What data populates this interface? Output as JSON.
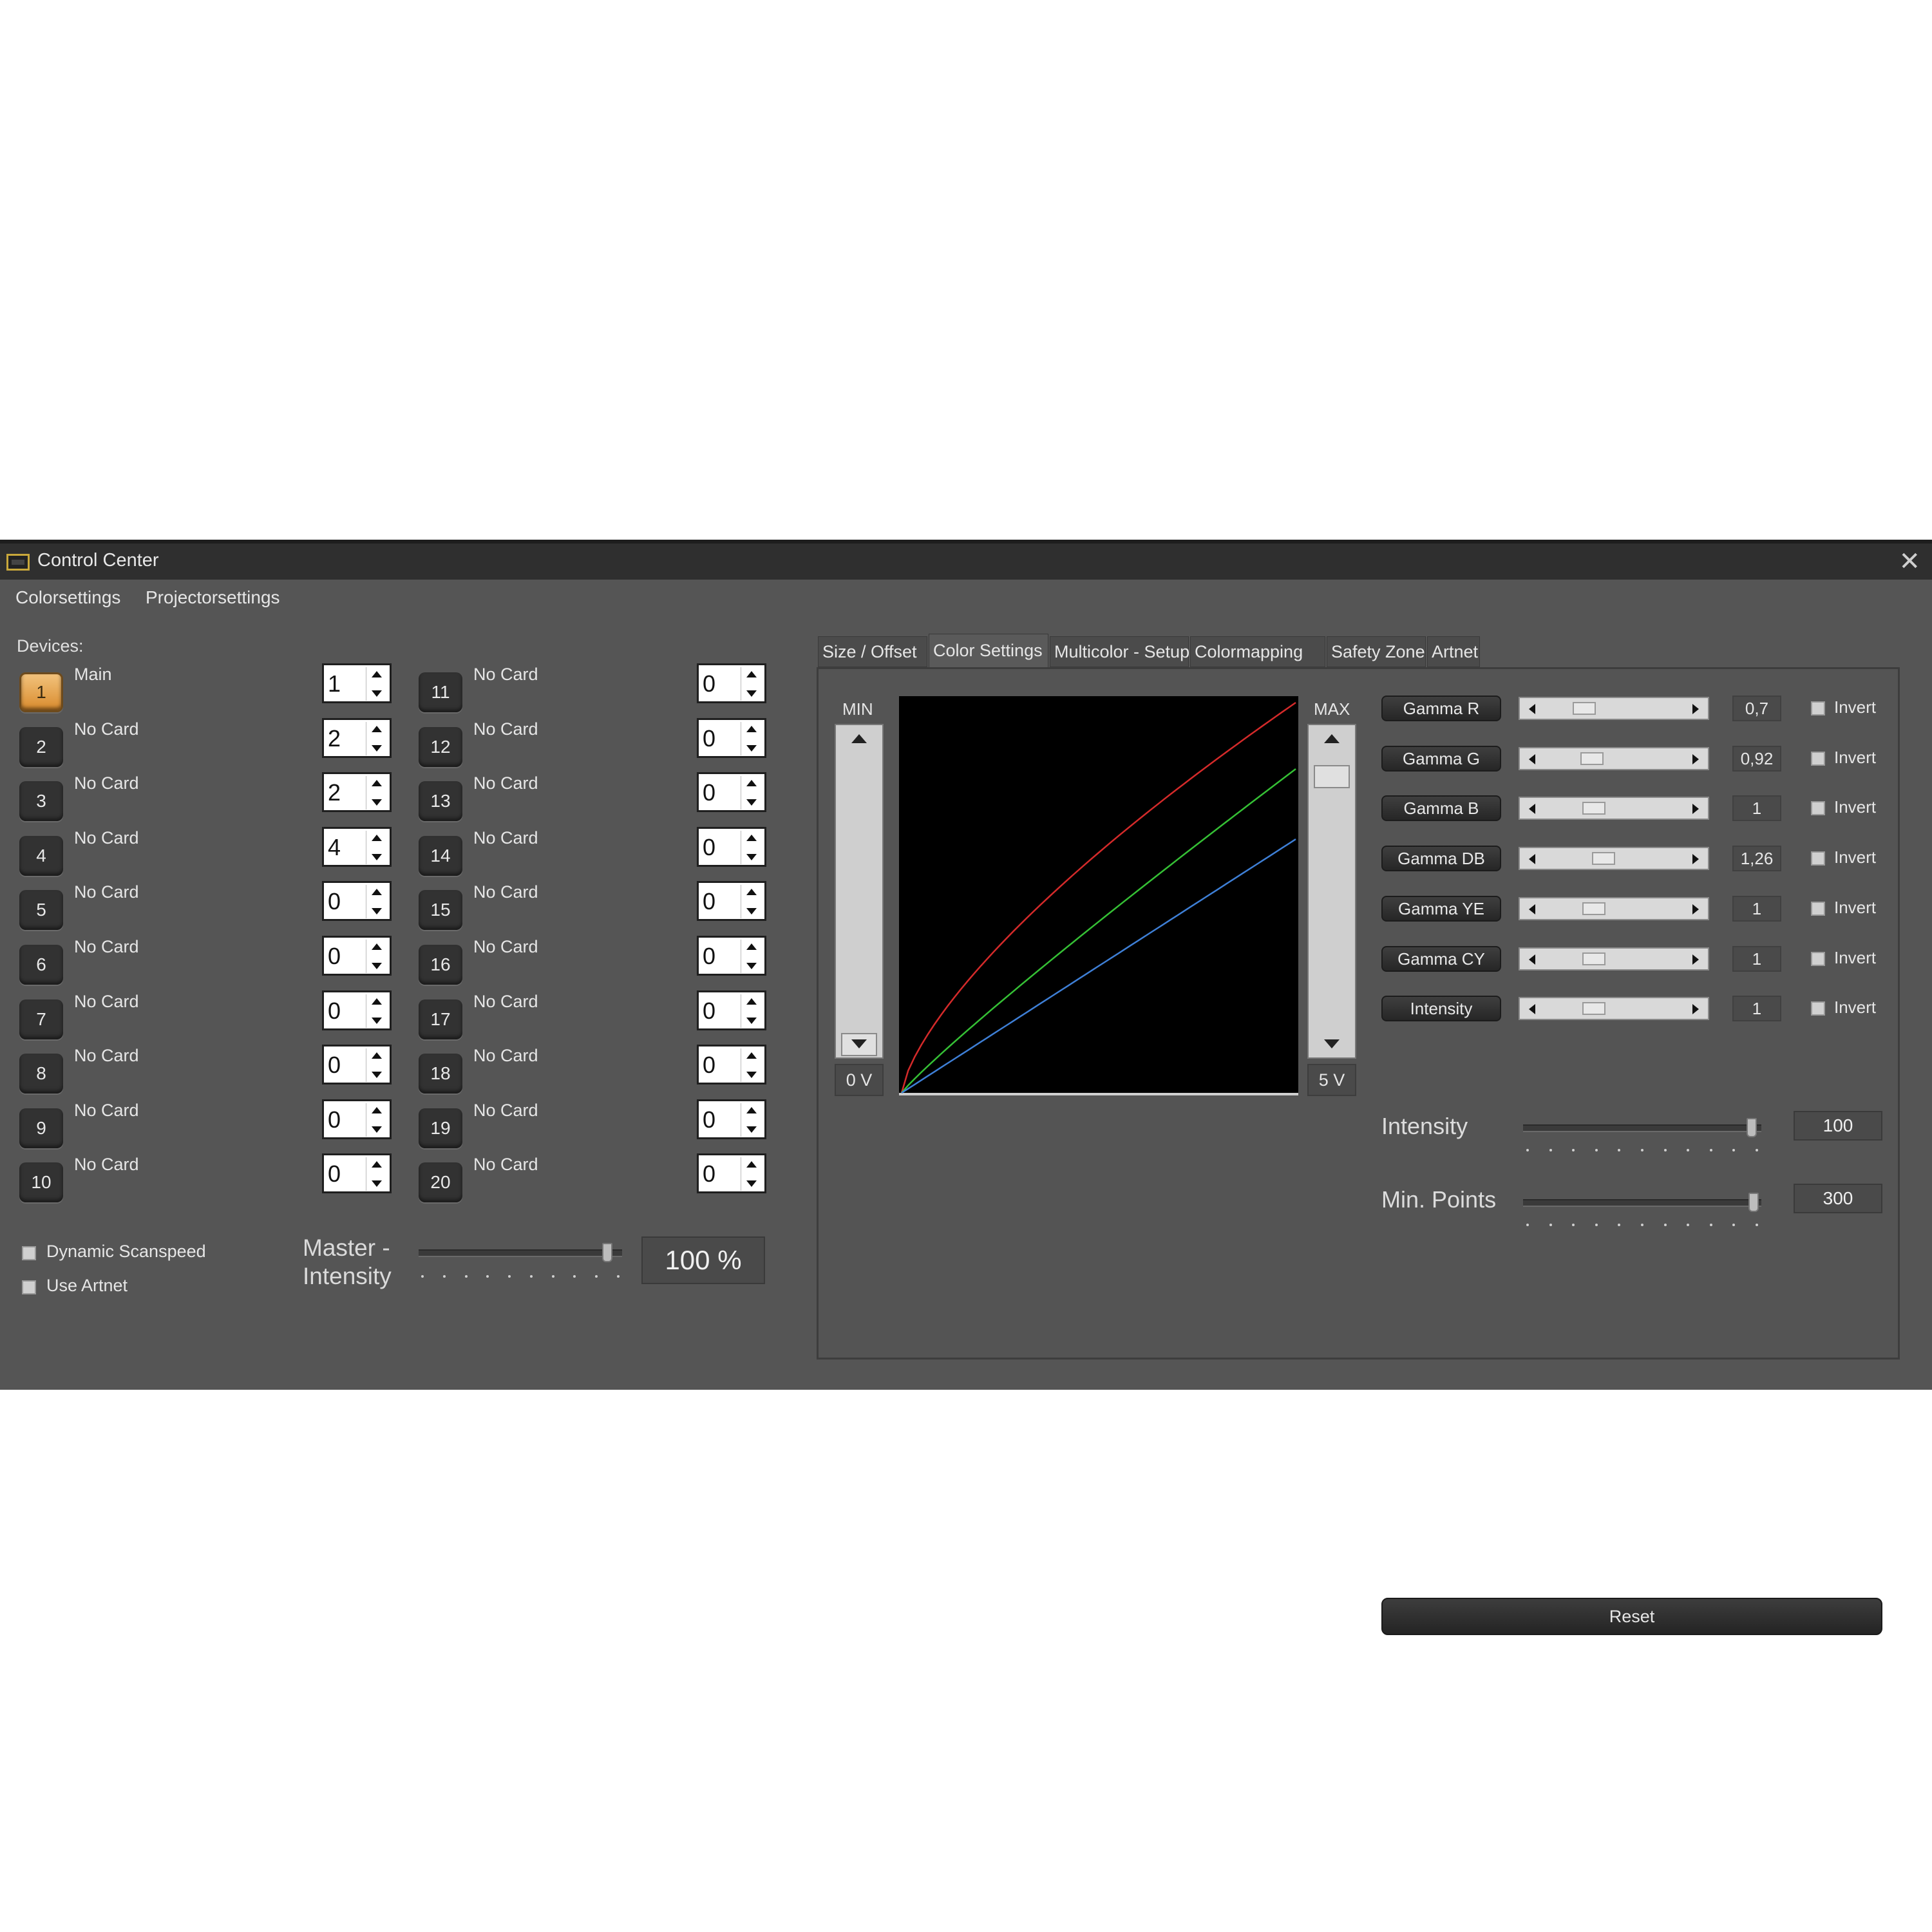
{
  "window": {
    "title": "Control Center"
  },
  "menu": [
    "Colorsettings",
    "Projectorsettings"
  ],
  "devices": {
    "label": "Devices:",
    "left": [
      {
        "num": "1",
        "name": "Main",
        "value": "1"
      },
      {
        "num": "2",
        "name": "No Card",
        "value": "2"
      },
      {
        "num": "3",
        "name": "No Card",
        "value": "2"
      },
      {
        "num": "4",
        "name": "No Card",
        "value": "4"
      },
      {
        "num": "5",
        "name": "No Card",
        "value": "0"
      },
      {
        "num": "6",
        "name": "No Card",
        "value": "0"
      },
      {
        "num": "7",
        "name": "No Card",
        "value": "0"
      },
      {
        "num": "8",
        "name": "No Card",
        "value": "0"
      },
      {
        "num": "9",
        "name": "No Card",
        "value": "0"
      },
      {
        "num": "10",
        "name": "No Card",
        "value": "0"
      }
    ],
    "right": [
      {
        "num": "11",
        "name": "No Card",
        "value": "0"
      },
      {
        "num": "12",
        "name": "No Card",
        "value": "0"
      },
      {
        "num": "13",
        "name": "No Card",
        "value": "0"
      },
      {
        "num": "14",
        "name": "No Card",
        "value": "0"
      },
      {
        "num": "15",
        "name": "No Card",
        "value": "0"
      },
      {
        "num": "16",
        "name": "No Card",
        "value": "0"
      },
      {
        "num": "17",
        "name": "No Card",
        "value": "0"
      },
      {
        "num": "18",
        "name": "No Card",
        "value": "0"
      },
      {
        "num": "19",
        "name": "No Card",
        "value": "0"
      },
      {
        "num": "20",
        "name": "No Card",
        "value": "0"
      }
    ],
    "active": "1"
  },
  "options": {
    "dynamic_scanspeed": "Dynamic Scanspeed",
    "use_artnet": "Use Artnet"
  },
  "master": {
    "label_line1": "Master -",
    "label_line2": "Intensity",
    "value": "100 %",
    "level": 1.0
  },
  "tabs": [
    "Size / Offset",
    "Color Settings",
    "Multicolor - Setup",
    "Colormapping",
    "Safety Zone",
    "Artnet"
  ],
  "active_tab": "Color Settings",
  "color_settings": {
    "min_label": "MIN",
    "max_label": "MAX",
    "min_voltage": "0 V",
    "max_voltage": "5 V",
    "min_level": 0.0,
    "max_level": 0.95,
    "params": [
      {
        "name": "Gamma R",
        "value": "0,7",
        "level": 0.15,
        "invert": "Invert"
      },
      {
        "name": "Gamma G",
        "value": "0,92",
        "level": 0.19,
        "invert": "Invert"
      },
      {
        "name": "Gamma B",
        "value": "1",
        "level": 0.2,
        "invert": "Invert"
      },
      {
        "name": "Gamma DB",
        "value": "1,26",
        "level": 0.25,
        "invert": "Invert"
      },
      {
        "name": "Gamma YE",
        "value": "1",
        "level": 0.2,
        "invert": "Invert"
      },
      {
        "name": "Gamma CY",
        "value": "1",
        "level": 0.2,
        "invert": "Invert"
      },
      {
        "name": "Intensity",
        "value": "1",
        "level": 0.2,
        "invert": "Invert"
      }
    ],
    "reset_label": "Reset",
    "intensity": {
      "label": "Intensity",
      "value": "100",
      "level": 1.0
    },
    "min_points": {
      "label": "Min. Points",
      "value": "300",
      "level": 1.0
    },
    "curves": [
      {
        "color": "#d42a2a",
        "gamma": 0.7,
        "end": 1.0
      },
      {
        "color": "#35c035",
        "gamma": 0.92,
        "end": 0.83
      },
      {
        "color": "#3e7fd6",
        "gamma": 1.0,
        "end": 0.65
      }
    ]
  },
  "colors": {
    "accent": "#e8a24a",
    "background": "#555555",
    "titlebar": "#2f2f2f"
  }
}
